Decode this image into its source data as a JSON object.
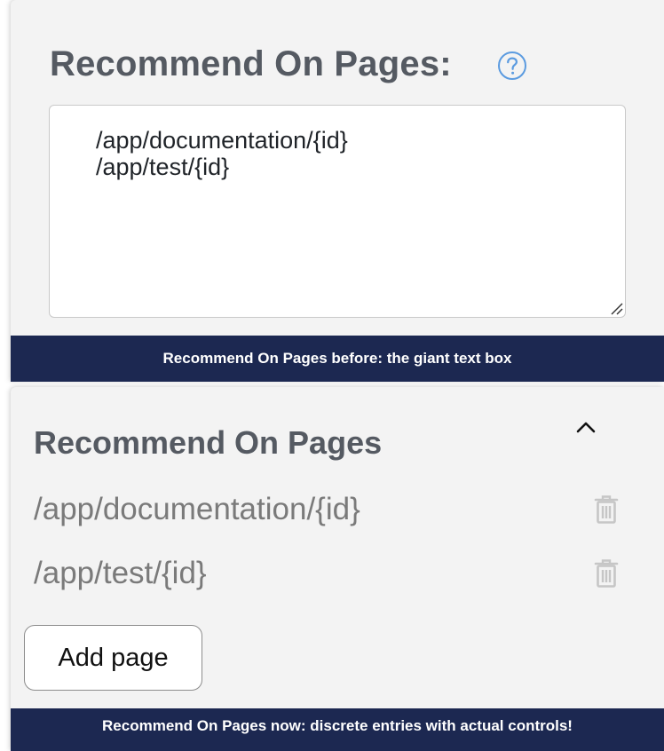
{
  "before": {
    "title": "Recommend On Pages:",
    "help_icon": "question-circle-icon",
    "textarea_value": "/app/documentation/{id}\n/app/test/{id}",
    "caption": "Recommend On Pages before: the giant text box",
    "accent_color": "#5b9be0"
  },
  "after": {
    "title": "Recommend On Pages",
    "toggle_icon": "chevron-up-icon",
    "pages": [
      {
        "path": "/app/documentation/{id}",
        "delete_icon": "trash-icon"
      },
      {
        "path": "/app/test/{id}",
        "delete_icon": "trash-icon"
      }
    ],
    "add_button_label": "Add page",
    "caption": "Recommend On Pages now: discrete entries with actual controls!"
  },
  "colors": {
    "panel_background": "#f3f3f3",
    "caption_background": "#1c2851",
    "title_text": "#555a62",
    "path_text": "#7a7a7a"
  }
}
